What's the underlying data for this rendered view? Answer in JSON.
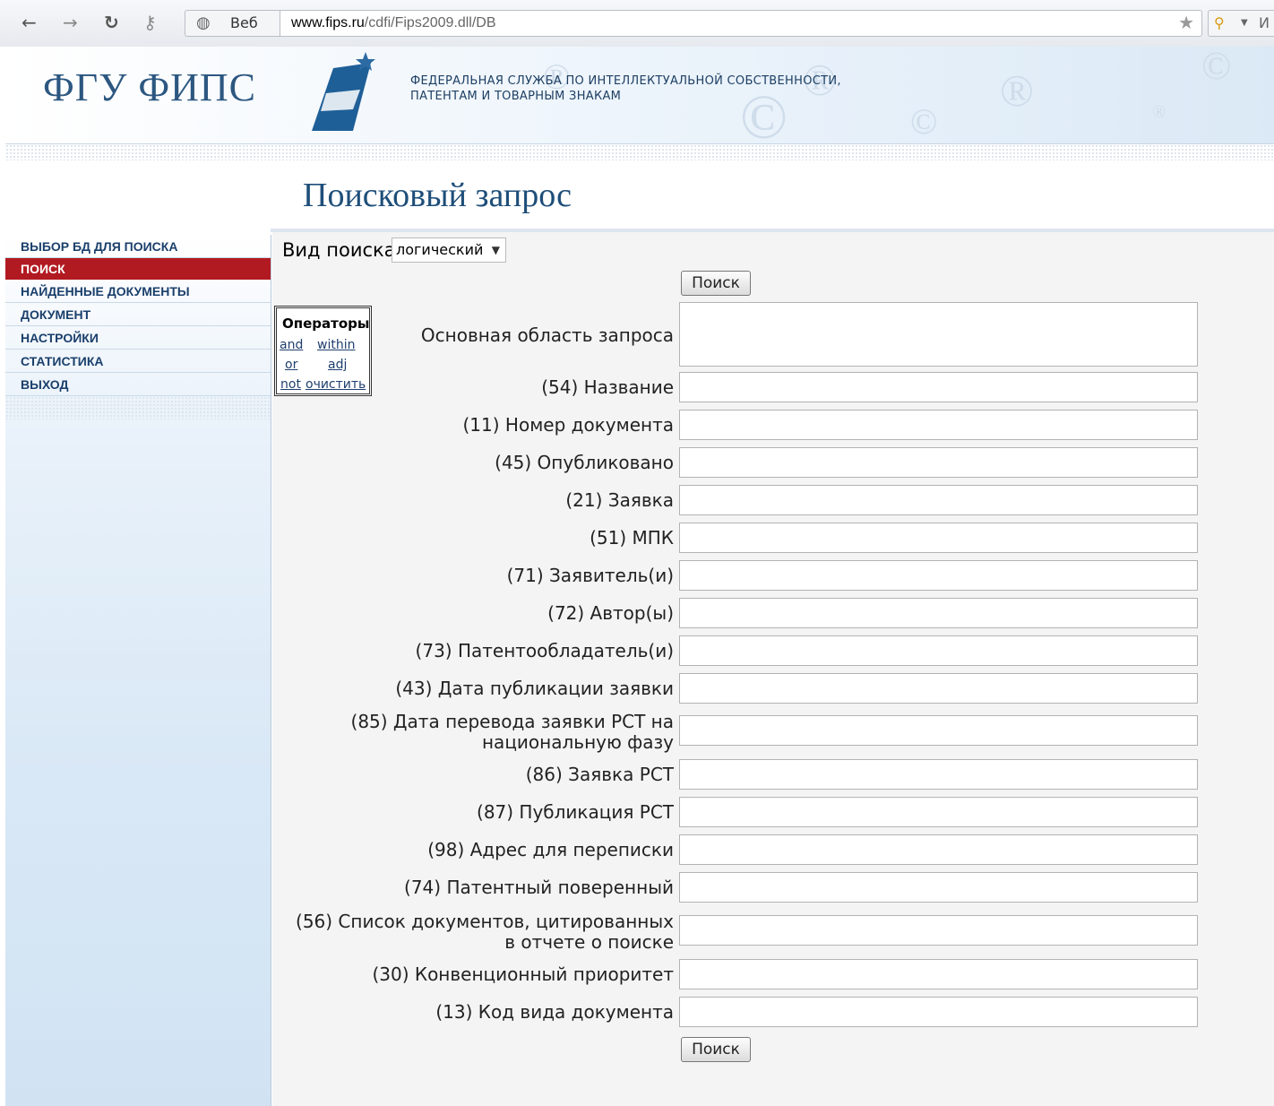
{
  "browser": {
    "back_icon": "←",
    "forward_icon": "→",
    "reload_icon": "↻",
    "key_icon": "⚷",
    "site_chip_label": "Веб",
    "url_host": "www.fips.ru",
    "url_path": "/cdfi/Fips2009.dll/DB",
    "extension_label": "И"
  },
  "header": {
    "logo": "ФГУ ФИПС",
    "agency_line1": "ФЕДЕРАЛЬНАЯ СЛУЖБА ПО ИНТЕЛЛЕКТУАЛЬНОЙ СОБСТВЕННОСТИ,",
    "agency_line2": "ПАТЕНТАМ И ТОВАРНЫМ ЗНАКАМ"
  },
  "page_title": "Поисковый запрос",
  "sidebar": {
    "items": [
      {
        "label": "ВЫБОР БД ДЛЯ ПОИСКА",
        "active": false
      },
      {
        "label": "ПОИСК",
        "active": true
      },
      {
        "label": "НАЙДЕННЫЕ ДОКУМЕНТЫ",
        "active": false
      },
      {
        "label": "ДОКУМЕНТ",
        "active": false
      },
      {
        "label": "НАСТРОЙКИ",
        "active": false
      },
      {
        "label": "СТАТИСТИКА",
        "active": false
      },
      {
        "label": "ВЫХОД",
        "active": false
      }
    ]
  },
  "search": {
    "type_label": "Вид поиска",
    "type_value": "логический",
    "button_label": "Поиск",
    "operators": {
      "title": "Операторы",
      "and": "and",
      "within": "within",
      "or": "or",
      "adj": "adj",
      "not": "not",
      "clear": "очистить"
    },
    "main_area_label": "Основная область запроса",
    "fields": [
      {
        "label": "(54) Название"
      },
      {
        "label": "(11) Номер документа"
      },
      {
        "label": "(45) Опубликовано"
      },
      {
        "label": "(21) Заявка"
      },
      {
        "label": "(51) МПК"
      },
      {
        "label": "(71) Заявитель(и)"
      },
      {
        "label": "(72) Автор(ы)"
      },
      {
        "label": "(73) Патентообладатель(и)"
      },
      {
        "label": "(43) Дата публикации заявки"
      },
      {
        "label": "(85) Дата перевода заявки РСТ на",
        "label2": "национальную фазу"
      },
      {
        "label": "(86) Заявка РСТ"
      },
      {
        "label": "(87) Публикация РСТ"
      },
      {
        "label": "(98) Адрес для переписки"
      },
      {
        "label": "(74) Патентный поверенный"
      },
      {
        "label": "(56) Список документов, цитированных",
        "label2": "в отчете о поиске"
      },
      {
        "label": "(30) Конвенционный приоритет"
      },
      {
        "label": "(13) Код вида документа"
      }
    ]
  }
}
